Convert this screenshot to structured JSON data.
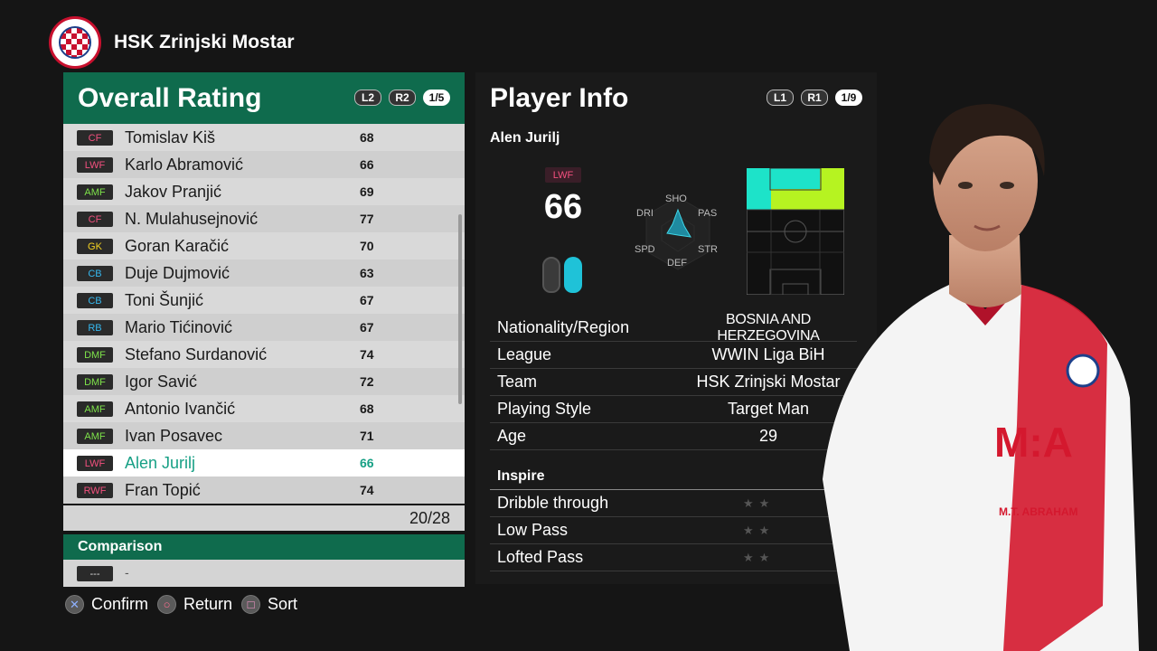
{
  "header": {
    "club_name": "HSK Zrinjski Mostar",
    "logo": "club-crest-icon"
  },
  "overall": {
    "title": "Overall Rating",
    "chips": [
      "L2",
      "R2"
    ],
    "page": "1/5",
    "players": [
      {
        "pos": "CF",
        "pos_color": "#f3507e",
        "name": "Tomislav Kiš",
        "rating": "68"
      },
      {
        "pos": "LWF",
        "pos_color": "#f3507e",
        "name": "Karlo Abramović",
        "rating": "66"
      },
      {
        "pos": "AMF",
        "pos_color": "#7ee34a",
        "name": "Jakov Pranjić",
        "rating": "69"
      },
      {
        "pos": "CF",
        "pos_color": "#f3507e",
        "name": "N. Mulahusejnović",
        "rating": "77"
      },
      {
        "pos": "GK",
        "pos_color": "#f5d321",
        "name": "Goran Karačić",
        "rating": "70"
      },
      {
        "pos": "CB",
        "pos_color": "#36b8ef",
        "name": "Duje Dujmović",
        "rating": "63"
      },
      {
        "pos": "CB",
        "pos_color": "#36b8ef",
        "name": "Toni Šunjić",
        "rating": "67"
      },
      {
        "pos": "RB",
        "pos_color": "#36b8ef",
        "name": "Mario Tićinović",
        "rating": "67"
      },
      {
        "pos": "DMF",
        "pos_color": "#7ee34a",
        "name": "Stefano Surdanović",
        "rating": "74"
      },
      {
        "pos": "DMF",
        "pos_color": "#7ee34a",
        "name": "Igor Savić",
        "rating": "72"
      },
      {
        "pos": "AMF",
        "pos_color": "#7ee34a",
        "name": "Antonio Ivančić",
        "rating": "68"
      },
      {
        "pos": "AMF",
        "pos_color": "#7ee34a",
        "name": "Ivan Posavec",
        "rating": "71"
      },
      {
        "pos": "LWF",
        "pos_color": "#f3507e",
        "name": "Alen Jurilj",
        "rating": "66",
        "selected": true
      },
      {
        "pos": "RWF",
        "pos_color": "#f3507e",
        "name": "Fran Topić",
        "rating": "74"
      }
    ],
    "count": "20/28"
  },
  "comparison": {
    "title": "Comparison",
    "pos": "---",
    "name": "-"
  },
  "controls": [
    {
      "label": "Confirm",
      "icon": "cross-button-icon",
      "glyph": "✕",
      "color": "#8fb1ff"
    },
    {
      "label": "Return",
      "icon": "circle-button-icon",
      "glyph": "○",
      "color": "#ff6d8f"
    },
    {
      "label": "Sort",
      "icon": "square-button-icon",
      "glyph": "□",
      "color": "#ff9ad1"
    }
  ],
  "player_info": {
    "title": "Player Info",
    "chips": [
      "L1",
      "R1"
    ],
    "page": "1/9",
    "name": "Alen Jurilj",
    "position": "LWF",
    "rating": "66",
    "radar_labels": {
      "sho": "SHO",
      "pas": "PAS",
      "str": "STR",
      "def": "DEF",
      "spd": "SPD",
      "dri": "DRI"
    },
    "details": [
      {
        "key": "Nationality/Region",
        "value": "BOSNIA AND HERZEGOVINA"
      },
      {
        "key": "League",
        "value": "WWIN Liga BiH"
      },
      {
        "key": "Team",
        "value": "HSK Zrinjski Mostar"
      },
      {
        "key": "Playing Style",
        "value": "Target Man"
      },
      {
        "key": "Age",
        "value": "29"
      }
    ],
    "inspire_title": "Inspire",
    "inspire": [
      {
        "label": "Dribble through",
        "stars": "★★"
      },
      {
        "label": "Low Pass",
        "stars": "★★"
      },
      {
        "label": "Lofted Pass",
        "stars": "★★"
      }
    ],
    "accent_color": "#17a085",
    "pitch_colors": {
      "primary": "#1de3c9",
      "secondary": "#b6f321"
    }
  }
}
